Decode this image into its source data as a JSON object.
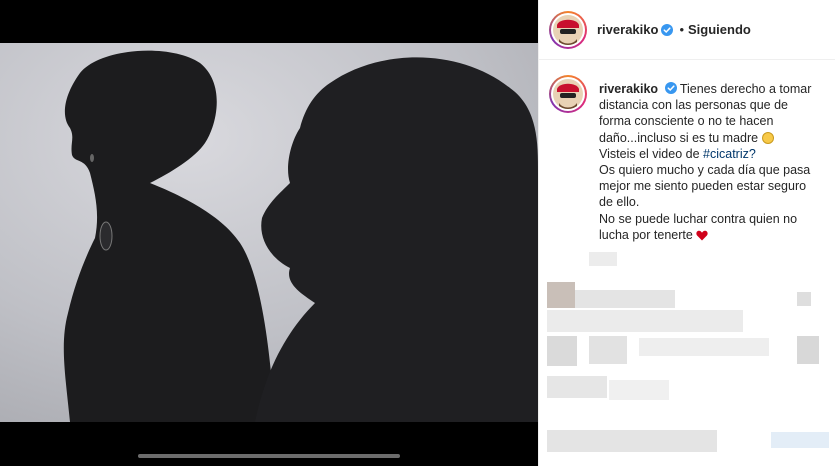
{
  "header": {
    "username": "riverakiko",
    "separator": "•",
    "follow_status": "Siguiendo"
  },
  "caption": {
    "username": "riverakiko",
    "lines": [
      "Tienes derecho a tomar",
      "distancia con las personas que de",
      "forma consciente o no te hacen",
      "daño...incluso si es tu madre",
      "Visteis el video de",
      "#cicatriz?",
      "Os quiero mucho y cada día que pasa",
      "mejor me siento pueden estar seguro",
      "de ello.",
      "No se puede luchar contra quien no",
      "lucha por tenerte"
    ]
  },
  "colors": {
    "verified": "#3897f0",
    "link": "#00376b",
    "heart": "#d0021b"
  },
  "icons": [
    "verified-badge-icon",
    "smile-emoji-icon",
    "red-heart-icon"
  ]
}
